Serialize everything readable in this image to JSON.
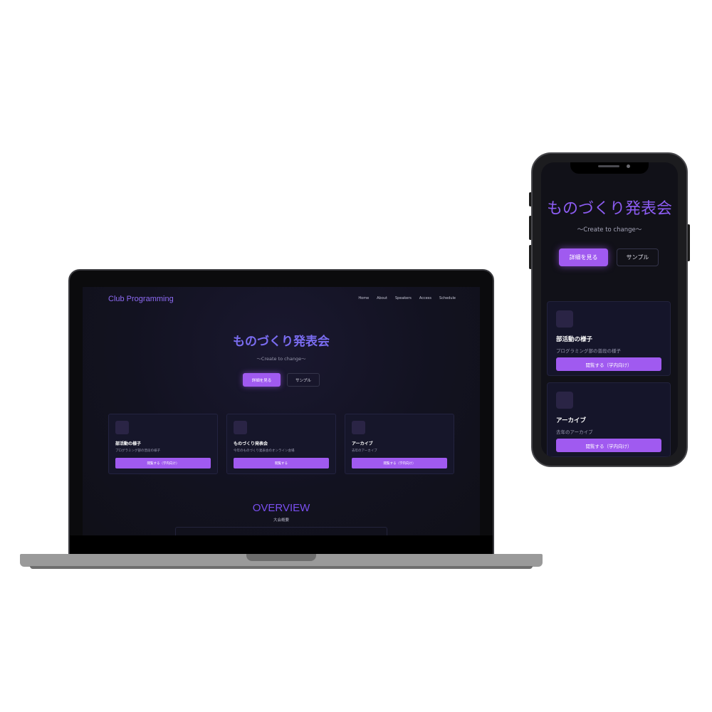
{
  "desktop": {
    "logo": "Club Programming",
    "nav": [
      "Home",
      "About",
      "Speakers",
      "Access",
      "Schedule"
    ],
    "hero": {
      "title": "ものづくり発表会",
      "subtitle": "〜Create to change〜",
      "primary_button": "詳細を見る",
      "secondary_button": "サンプル"
    },
    "cards": [
      {
        "title": "部活動の様子",
        "description": "プログラミング部の普段の様子",
        "button": "閲覧する（学内向け）"
      },
      {
        "title": "ものづくり発表会",
        "description": "今年のものづくり発表会のオンライン会場",
        "button": "閲覧する"
      },
      {
        "title": "アーカイブ",
        "description": "去年のアーカイブ",
        "button": "閲覧する（学内向け）"
      }
    ],
    "overview": {
      "title": "OVERVIEW",
      "subtitle": "大会概要"
    }
  },
  "mobile": {
    "hero": {
      "title": "ものづくり発表会",
      "subtitle": "〜Create to change〜",
      "primary_button": "詳細を見る",
      "secondary_button": "サンプル"
    },
    "cards": [
      {
        "title": "部活動の様子",
        "description": "プログラミング部の普段の様子",
        "button": "閲覧する（学内向け）"
      },
      {
        "title": "アーカイブ",
        "description": "去年のアーカイブ",
        "button": "閲覧する（学内向け）"
      }
    ]
  },
  "colors": {
    "accent": "#a05af0",
    "title_gradient": "#7a6cf0",
    "background": "#121220",
    "card": "#16162a"
  }
}
